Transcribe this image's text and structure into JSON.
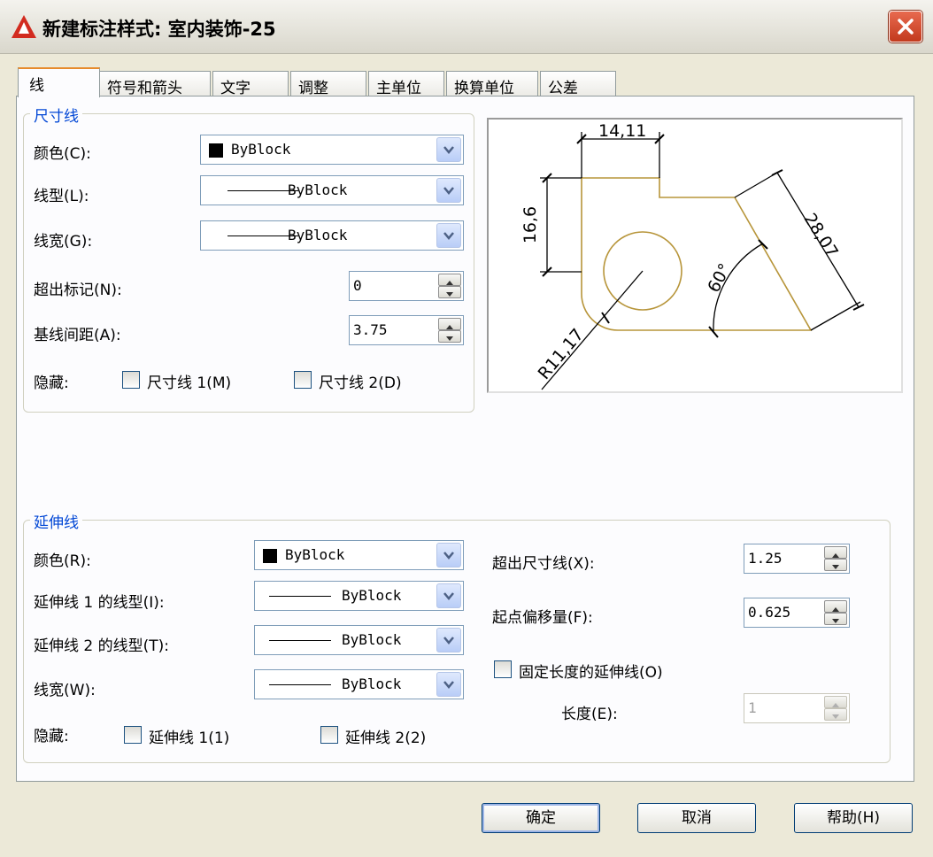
{
  "window": {
    "title": "新建标注样式: 室内装饰-25",
    "accent_color": "#e68b2c",
    "legend_color": "#0046d5"
  },
  "tabs": [
    {
      "label": "线",
      "active": true
    },
    {
      "label": "符号和箭头"
    },
    {
      "label": "文字"
    },
    {
      "label": "调整"
    },
    {
      "label": "主单位"
    },
    {
      "label": "换算单位"
    },
    {
      "label": "公差"
    }
  ],
  "dimension_lines": {
    "legend": "尺寸线",
    "color_label": "颜色(C):",
    "color_value": "ByBlock",
    "linetype_label": "线型(L):",
    "linetype_value": "ByBlock",
    "lineweight_label": "线宽(G):",
    "lineweight_value": "ByBlock",
    "extend_ticks_label": "超出标记(N):",
    "extend_ticks_value": "0",
    "baseline_spacing_label": "基线间距(A):",
    "baseline_spacing_value": "3.75",
    "suppress_label": "隐藏:",
    "suppress_1": "尺寸线 1(M)",
    "suppress_2": "尺寸线 2(D)"
  },
  "preview": {
    "dim_top": "14,11",
    "dim_left": "16,6",
    "dim_right": "28,07",
    "dim_angle": "60°",
    "dim_radius": "R11,17"
  },
  "extension_lines": {
    "legend": "延伸线",
    "color_label": "颜色(R):",
    "color_value": "ByBlock",
    "linetype1_label": "延伸线 1 的线型(I):",
    "linetype1_value": "ByBlock",
    "linetype2_label": "延伸线 2 的线型(T):",
    "linetype2_value": "ByBlock",
    "lineweight_label": "线宽(W):",
    "lineweight_value": "ByBlock",
    "suppress_label": "隐藏:",
    "suppress_1": "延伸线 1(1)",
    "suppress_2": "延伸线 2(2)",
    "extend_beyond_label": "超出尺寸线(X):",
    "extend_beyond_value": "1.25",
    "offset_label": "起点偏移量(F):",
    "offset_value": "0.625",
    "fixed_length_label": "固定长度的延伸线(O)",
    "length_label": "长度(E):",
    "length_value": "1"
  },
  "buttons": {
    "ok": "确定",
    "cancel": "取消",
    "help": "帮助(H)"
  }
}
